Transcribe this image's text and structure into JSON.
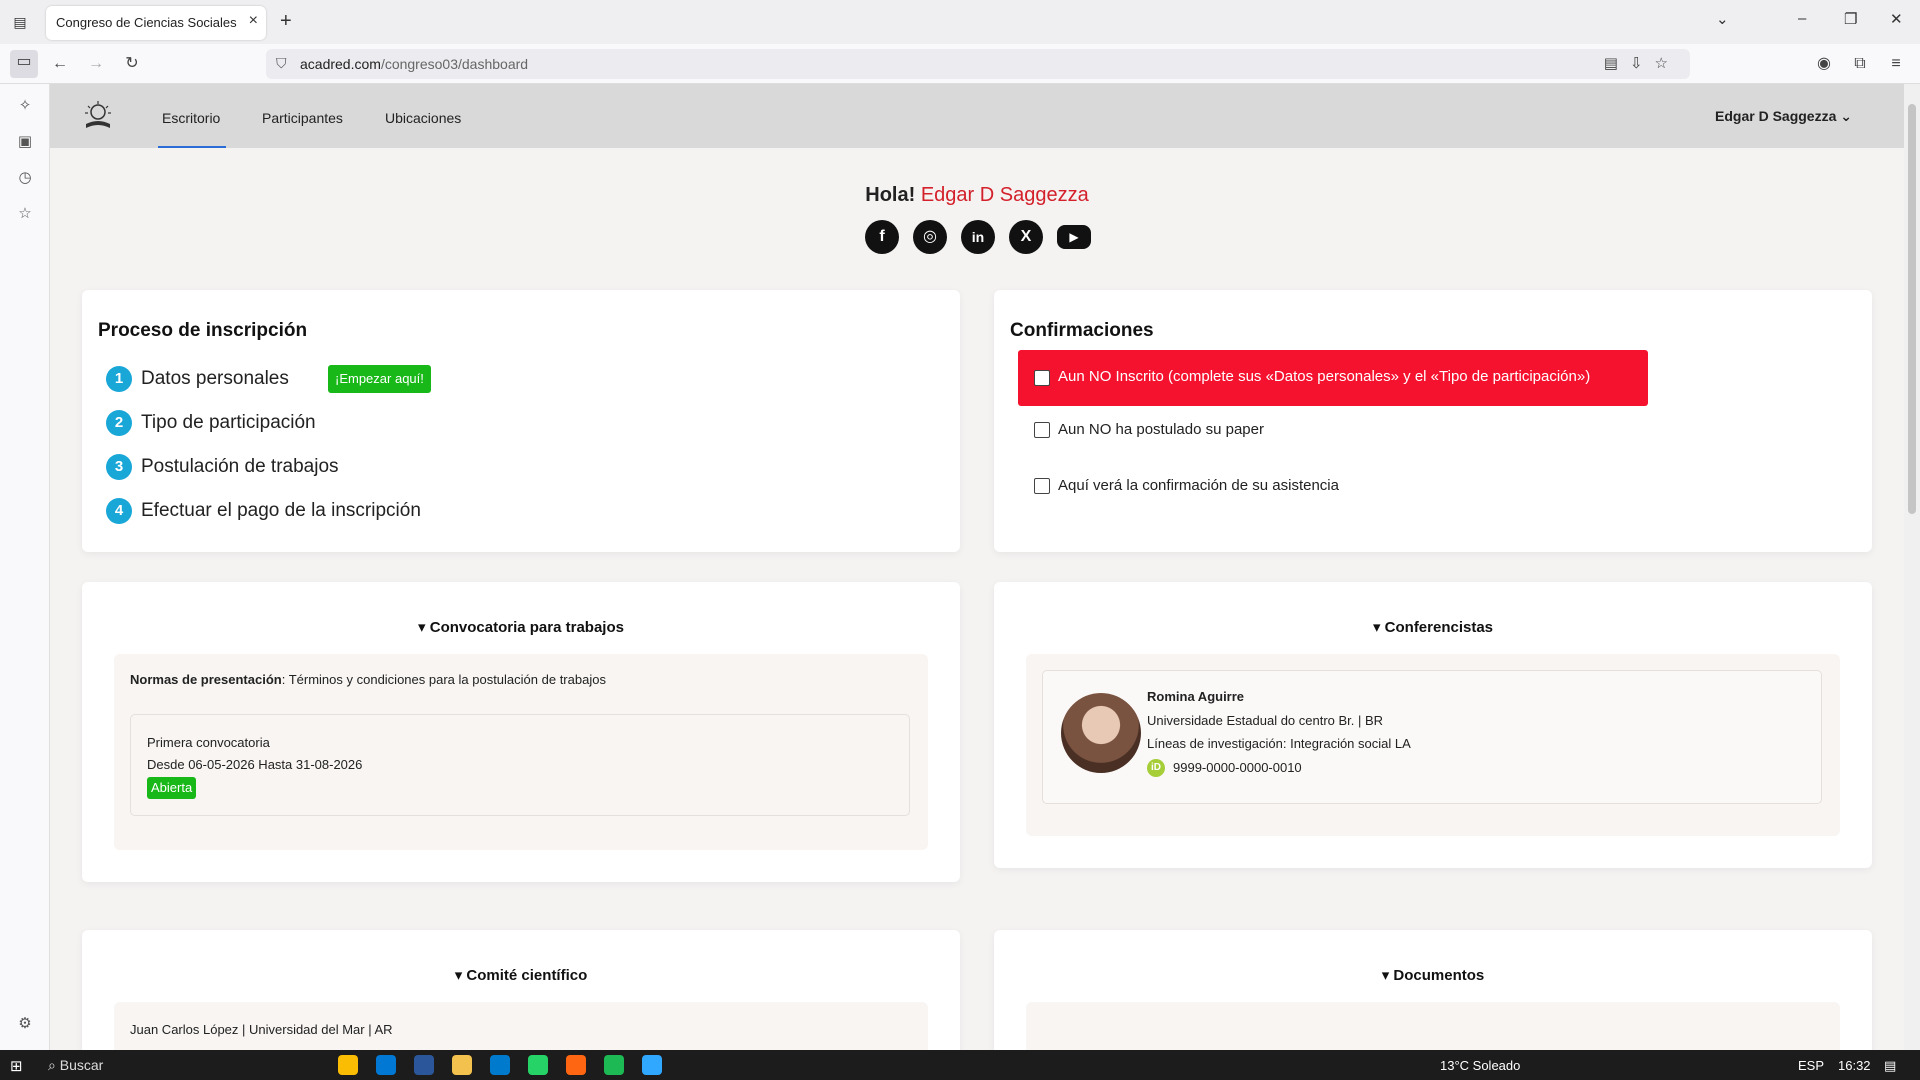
{
  "browser": {
    "tab_title": "Congreso de Ciencias Sociales",
    "url_host": "acadred.com",
    "url_path": "/congreso03/dashboard"
  },
  "nav": {
    "items": [
      "Escritorio",
      "Participantes",
      "Ubicaciones"
    ],
    "active": "Escritorio",
    "user": "Edgar D Saggezza"
  },
  "greeting": {
    "prefix": "Hola!",
    "name": "Edgar D Saggezza"
  },
  "socials": [
    "facebook-icon",
    "instagram-icon",
    "linkedin-icon",
    "x-icon",
    "youtube-icon"
  ],
  "registration": {
    "title": "Proceso de inscripción",
    "steps": [
      {
        "num": "1",
        "label": "Datos personales"
      },
      {
        "num": "2",
        "label": "Tipo de participación"
      },
      {
        "num": "3",
        "label": "Postulación de trabajos"
      },
      {
        "num": "4",
        "label": "Efectuar el pago de la inscripción"
      }
    ],
    "start_badge": "¡Empezar aquí!"
  },
  "confirmations": {
    "title": "Confirmaciones",
    "items": [
      "Aun NO Inscrito (complete sus «Datos personales» y el «Tipo de participación»)",
      "Aun NO ha postulado su paper",
      "Aquí verá la confirmación de su asistencia"
    ]
  },
  "call": {
    "title": "Convocatoria para trabajos",
    "norms_label": "Normas de presentación",
    "norms_text": ": Términos y condiciones para la postulación de trabajos",
    "entry_title": "Primera convocatoria",
    "entry_dates": "Desde 06-05-2026 Hasta 31-08-2026",
    "entry_status": "Abierta"
  },
  "speakers": {
    "title": "Conferencistas",
    "name": "Romina Aguirre",
    "institution": "Universidade Estadual do centro Br. | BR",
    "research": "Líneas de investigación: Integración social LA",
    "orcid": "9999-0000-0000-0010",
    "orcid_badge": "iD"
  },
  "committee": {
    "title": "Comité científico",
    "first_member": "Juan Carlos López | Universidad del Mar | AR"
  },
  "documents": {
    "title": "Documentos"
  },
  "taskbar": {
    "search": "Buscar",
    "weather": "13°C  Soleado",
    "lang": "ESP",
    "time": "16:32"
  }
}
